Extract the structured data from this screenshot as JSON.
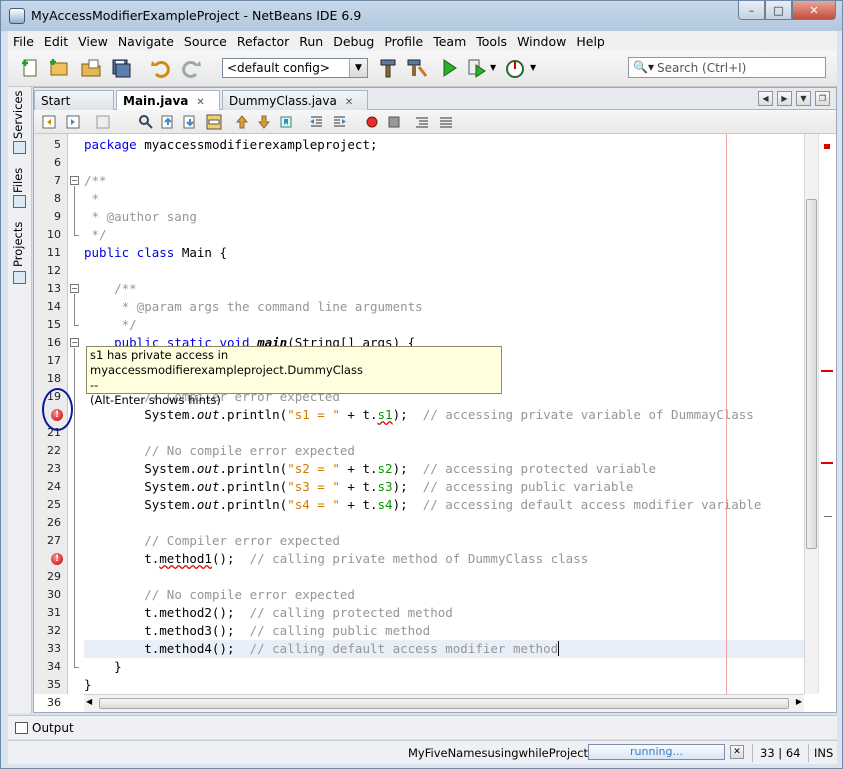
{
  "window": {
    "title": "MyAccessModifierExampleProject - NetBeans IDE 6.9",
    "buttons": {
      "minimize": "–",
      "maximize": "□",
      "close": "✕"
    }
  },
  "menu": [
    "File",
    "Edit",
    "View",
    "Navigate",
    "Source",
    "Refactor",
    "Run",
    "Debug",
    "Profile",
    "Team",
    "Tools",
    "Window",
    "Help"
  ],
  "toolbar": {
    "config_value": "<default config>",
    "search_placeholder": "Search (Ctrl+I)"
  },
  "side_tabs": [
    "Services",
    "Files",
    "Projects"
  ],
  "editor_tabs": [
    {
      "label": "Start Page",
      "active": false
    },
    {
      "label": "Main.java",
      "active": true
    },
    {
      "label": "DummyClass.java",
      "active": false
    }
  ],
  "tooltip": {
    "line1": "s1 has private access in myaccessmodifierexampleproject.DummyClass",
    "line2": "--",
    "line3": "(Alt-Enter shows hints)"
  },
  "code_lines": [
    {
      "n": "5",
      "html": "<span class=\"kw\">package</span> myaccessmodifierexampleproject;"
    },
    {
      "n": "6",
      "html": ""
    },
    {
      "n": "7",
      "html": "<span class=\"cm\">/**</span>"
    },
    {
      "n": "8",
      "html": "<span class=\"cm\"> *</span>"
    },
    {
      "n": "9",
      "html": "<span class=\"cm\"> * @author sang</span>"
    },
    {
      "n": "10",
      "html": "<span class=\"cm\"> */</span>"
    },
    {
      "n": "11",
      "html": "<span class=\"kw\">public class</span> Main {"
    },
    {
      "n": "12",
      "html": ""
    },
    {
      "n": "13",
      "html": "    <span class=\"cm\">/**</span>"
    },
    {
      "n": "14",
      "html": "<span class=\"cm\">     * @param args the command line arguments</span>"
    },
    {
      "n": "15",
      "html": "<span class=\"cm\">     */</span>"
    },
    {
      "n": "16",
      "html": "    <span class=\"kw\">public static void</span> <span class=\"bi\">main</span>(String[] args) {"
    },
    {
      "n": "17",
      "html": ""
    },
    {
      "n": "18",
      "html": ""
    },
    {
      "n": "19",
      "html": "        <span class=\"cm\">// Compiler error expected</span>"
    },
    {
      "n": "",
      "html": "        System.<span class=\"it\">out</span>.println(<span class=\"st\">\"s1 = \"</span> + t.<span class=\"fld err\">s1</span>);  <span class=\"cm\">// accessing private variable of DummayClass</span>"
    },
    {
      "n": "21",
      "html": ""
    },
    {
      "n": "22",
      "html": "        <span class=\"cm\">// No compile error expected</span>"
    },
    {
      "n": "23",
      "html": "        System.<span class=\"it\">out</span>.println(<span class=\"st\">\"s2 = \"</span> + t.<span class=\"fld\">s2</span>);  <span class=\"cm\">// accessing protected variable</span>"
    },
    {
      "n": "24",
      "html": "        System.<span class=\"it\">out</span>.println(<span class=\"st\">\"s3 = \"</span> + t.<span class=\"fld\">s3</span>);  <span class=\"cm\">// accessing public variable</span>"
    },
    {
      "n": "25",
      "html": "        System.<span class=\"it\">out</span>.println(<span class=\"st\">\"s4 = \"</span> + t.<span class=\"fld\">s4</span>);  <span class=\"cm\">// accessing default access modifier variable</span>"
    },
    {
      "n": "26",
      "html": ""
    },
    {
      "n": "27",
      "html": "        <span class=\"cm\">// Compiler error expected</span>"
    },
    {
      "n": "",
      "html": "        t.<span class=\"err\">method1</span>();  <span class=\"cm\">// calling private method of DummyClass class</span>"
    },
    {
      "n": "29",
      "html": ""
    },
    {
      "n": "30",
      "html": "        <span class=\"cm\">// No compile error expected</span>"
    },
    {
      "n": "31",
      "html": "        t.method2();  <span class=\"cm\">// calling protected method</span>"
    },
    {
      "n": "32",
      "html": "        t.method3();  <span class=\"cm\">// calling public method</span>"
    },
    {
      "n": "33",
      "html": "        t.method4();  <span class=\"cm\">// calling default access modifier method</span>"
    },
    {
      "n": "34",
      "html": "    }"
    },
    {
      "n": "35",
      "html": "}"
    },
    {
      "n": "36",
      "html": ""
    }
  ],
  "output_label": "Output",
  "status": {
    "project": "MyFiveNamesusingwhileProject (run)",
    "progress": "running...",
    "position": "33 | 64",
    "mode": "INS"
  },
  "colors": {
    "keyword": "#0000e6",
    "comment": "#969696",
    "string": "#ce7b00",
    "field": "#009900",
    "error": "#e00000"
  }
}
